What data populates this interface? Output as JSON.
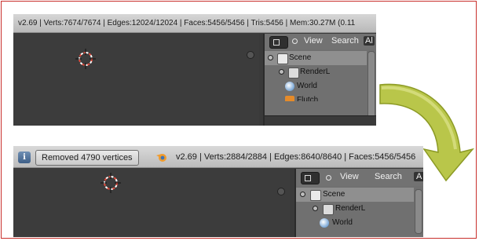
{
  "top_screenshot": {
    "stats": "v2.69 | Verts:7674/7674 | Edges:12024/12024 | Faces:5456/5456 | Tris:5456 | Mem:30.27M (0.11",
    "outliner": {
      "menu_view": "View",
      "menu_search": "Search",
      "menu_all": "Al",
      "rows": [
        "Scene",
        "RenderL",
        "World",
        "Flutch"
      ]
    }
  },
  "bottom_screenshot": {
    "info_icon": "i",
    "notice": "Removed 4790 vertices",
    "stats": "v2.69 | Verts:2884/2884 | Edges:8640/8640 | Faces:5456/5456",
    "outliner": {
      "menu_view": "View",
      "menu_search": "Search",
      "menu_all": "A",
      "rows": [
        "Scene",
        "RenderL",
        "World"
      ]
    }
  },
  "colors": {
    "frame_border": "#c9302c",
    "arrow_fill": "#b9c64a",
    "cursor_red": "#e04a3b"
  },
  "icons": [
    "info-icon",
    "blender-logo-icon",
    "3d-cursor-icon",
    "editor-type-icon",
    "scene-icon",
    "render-layers-icon",
    "world-icon",
    "curved-arrow-icon"
  ]
}
